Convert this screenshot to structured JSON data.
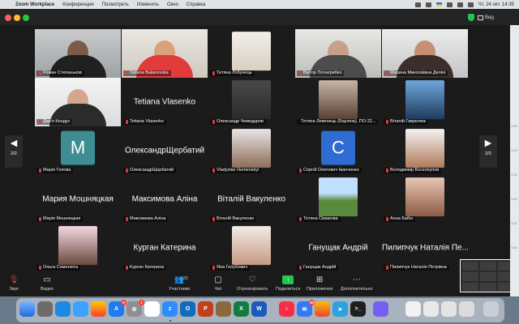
{
  "menubar": {
    "app": "Zoom Workplace",
    "items": [
      "Конференция",
      "Посмотреть",
      "Изменить",
      "Окно",
      "Справка"
    ],
    "datetime": "Чт, 24 окт.  14:35"
  },
  "window": {
    "view_label": "Вид"
  },
  "pager": {
    "left": "2/2",
    "right": "2/2"
  },
  "tiles": [
    {
      "name": "Роман Степаньков",
      "big": ""
    },
    {
      "name": "Tetiana Balanovska",
      "big": ""
    },
    {
      "name": "Тетяна Лобунець",
      "big": ""
    },
    {
      "name": "Віктор Погнерибко",
      "big": ""
    },
    {
      "name": "Марина Миколаївна Деліні",
      "big": ""
    },
    {
      "name": "Дар'я Кендус",
      "big": ""
    },
    {
      "name": "Tetiana Vlasenko",
      "big": "Tetiana Vlasenko"
    },
    {
      "name": "Олександр Чемодуров",
      "big": ""
    },
    {
      "name": "Тетяна Левенець (Бауліна), ПО-22...",
      "big": ""
    },
    {
      "name": "Віталій Гаврилюк",
      "big": ""
    },
    {
      "name": "Марія Голова",
      "big": "",
      "avatar": "М"
    },
    {
      "name": "ОлександрЩербатий",
      "big": "ОлександрЩербатий"
    },
    {
      "name": "Vladyslav Humenskyi",
      "big": ""
    },
    {
      "name": "Сергій Олегович Іванченко",
      "big": "",
      "avatar": "С"
    },
    {
      "name": "Володимир Воскопупов",
      "big": ""
    },
    {
      "name": "Марія Мошняцкая",
      "big": "Мария Мошняцкая"
    },
    {
      "name": "Максимова Аліна",
      "big": "Максимова Аліна"
    },
    {
      "name": "Віталій Вакуленко",
      "big": "Віталій Вакуленко"
    },
    {
      "name": "Тетяна Сімакова",
      "big": ""
    },
    {
      "name": "Анна Бабін",
      "big": ""
    },
    {
      "name": "Ольга Семенюта",
      "big": ""
    },
    {
      "name": "Курган Катерина",
      "big": "Курган Катерина"
    },
    {
      "name": "Яна Голубович",
      "big": ""
    },
    {
      "name": "Ганущак Андрій",
      "big": "Ганущак Андрій"
    },
    {
      "name": "Пилипчук Наталія Петрівна",
      "big": "Пилипчук Наталія Пе..."
    }
  ],
  "toolbar": {
    "audio": "Звук",
    "video": "Видео",
    "participants": "Участники",
    "participants_count": "33",
    "chat": "Чат",
    "react": "Отреагировать",
    "share": "Поделиться",
    "apps": "Приложения",
    "more": "Дополнительно"
  },
  "dock": {
    "badges": {
      "appstore": "6",
      "settings": "1",
      "mail": "40"
    }
  },
  "right_strip": [
    "1:03",
    "1:03",
    "1:02",
    "1:02",
    "1:01",
    "1:00"
  ],
  "colors": {
    "avatar_m": "#3d8d93",
    "avatar_s": "#2f6bd0",
    "mic_muted": "#e03c3c",
    "share_green": "#23c552"
  }
}
